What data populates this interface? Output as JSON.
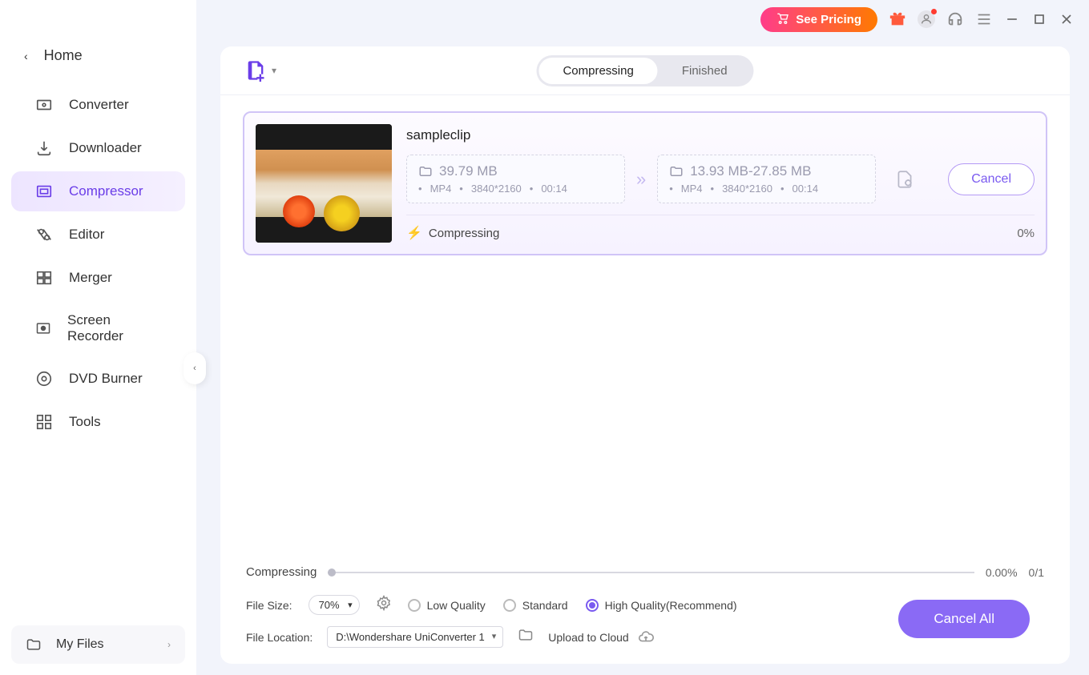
{
  "sidebar": {
    "home": "Home",
    "items": [
      {
        "label": "Converter"
      },
      {
        "label": "Downloader"
      },
      {
        "label": "Compressor"
      },
      {
        "label": "Editor"
      },
      {
        "label": "Merger"
      },
      {
        "label": "Screen Recorder"
      },
      {
        "label": "DVD Burner"
      },
      {
        "label": "Tools"
      }
    ],
    "myfiles": "My Files"
  },
  "titlebar": {
    "pricing": "See Pricing"
  },
  "tabs": {
    "compressing": "Compressing",
    "finished": "Finished"
  },
  "task": {
    "title": "sampleclip",
    "src_size": "39.79 MB",
    "src_format": "MP4",
    "src_res": "3840*2160",
    "src_dur": "00:14",
    "dst_size": "13.93 MB-27.85 MB",
    "dst_format": "MP4",
    "dst_res": "3840*2160",
    "dst_dur": "00:14",
    "status": "Compressing",
    "pct": "0%",
    "cancel": "Cancel"
  },
  "progress": {
    "label": "Compressing",
    "pct": "0.00%",
    "count": "0/1"
  },
  "options": {
    "filesize_label": "File Size:",
    "filesize_value": "70%",
    "quality": {
      "low": "Low Quality",
      "standard": "Standard",
      "high": "High Quality(Recommend)"
    },
    "location_label": "File Location:",
    "location_value": "D:\\Wondershare UniConverter 1",
    "upload_cloud": "Upload to Cloud"
  },
  "actions": {
    "cancel_all": "Cancel All"
  }
}
